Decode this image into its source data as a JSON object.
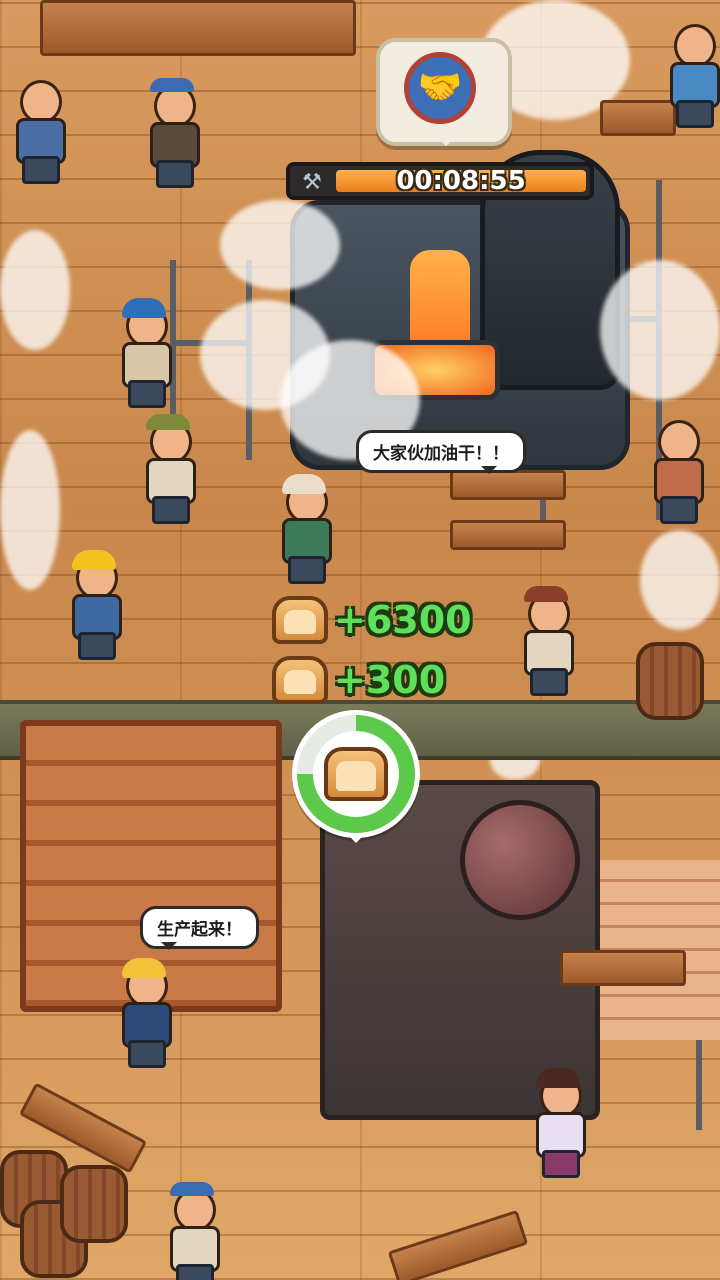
{
  "timer": {
    "text": "00:08:55",
    "icon": "hammer-icon"
  },
  "deal": {
    "icon": "handshake-icon"
  },
  "speech": {
    "worker_cheer": "大家伙加油干！！",
    "produce_cheer": "生产起来！"
  },
  "rewards": [
    {
      "icon": "bread-icon",
      "amount": "+6300"
    },
    {
      "icon": "bread-icon",
      "amount": "+300"
    }
  ],
  "production": {
    "icon": "bread-icon",
    "progress": 0.75,
    "fill_color": "#5cc94a"
  },
  "colors": {
    "reward_green": "#5fe05a",
    "timer_orange": "#ea7f1c"
  }
}
